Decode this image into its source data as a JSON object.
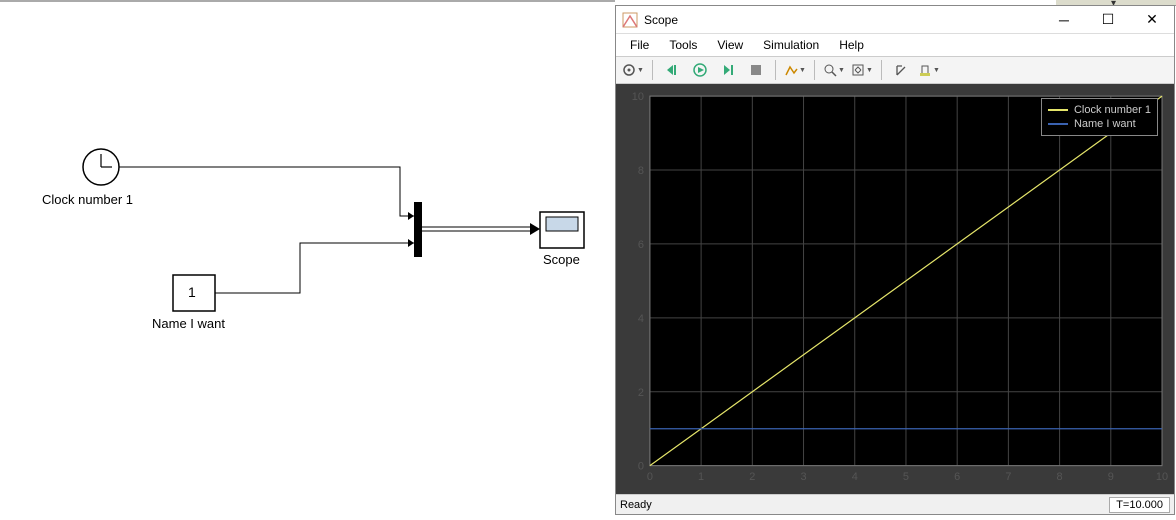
{
  "simulink": {
    "clock_label": "Clock number 1",
    "const_value": "1",
    "const_label": "Name I want",
    "scope_label": "Scope"
  },
  "scope_window": {
    "title": "Scope",
    "menu": {
      "file": "File",
      "tools": "Tools",
      "view": "View",
      "simulation": "Simulation",
      "help": "Help"
    },
    "legend": {
      "series1": "Clock number 1",
      "series2": "Name I want"
    },
    "status": {
      "ready": "Ready",
      "time": "T=10.000"
    }
  },
  "chart_data": {
    "type": "line",
    "xlabel": "",
    "ylabel": "",
    "xlim": [
      0,
      10
    ],
    "ylim": [
      0,
      10
    ],
    "xticks": [
      0,
      1,
      2,
      3,
      4,
      5,
      6,
      7,
      8,
      9,
      10
    ],
    "yticks": [
      0,
      2,
      4,
      6,
      8,
      10
    ],
    "series": [
      {
        "name": "Clock number 1",
        "color": "#e5e56a",
        "x": [
          0,
          1,
          2,
          3,
          4,
          5,
          6,
          7,
          8,
          9,
          10
        ],
        "y": [
          0,
          1,
          2,
          3,
          4,
          5,
          6,
          7,
          8,
          9,
          10
        ]
      },
      {
        "name": "Name I want",
        "color": "#3a62b0",
        "x": [
          0,
          1,
          2,
          3,
          4,
          5,
          6,
          7,
          8,
          9,
          10
        ],
        "y": [
          1,
          1,
          1,
          1,
          1,
          1,
          1,
          1,
          1,
          1,
          1
        ]
      }
    ],
    "legend_position": "top-right",
    "grid": true,
    "background": "#000000"
  }
}
